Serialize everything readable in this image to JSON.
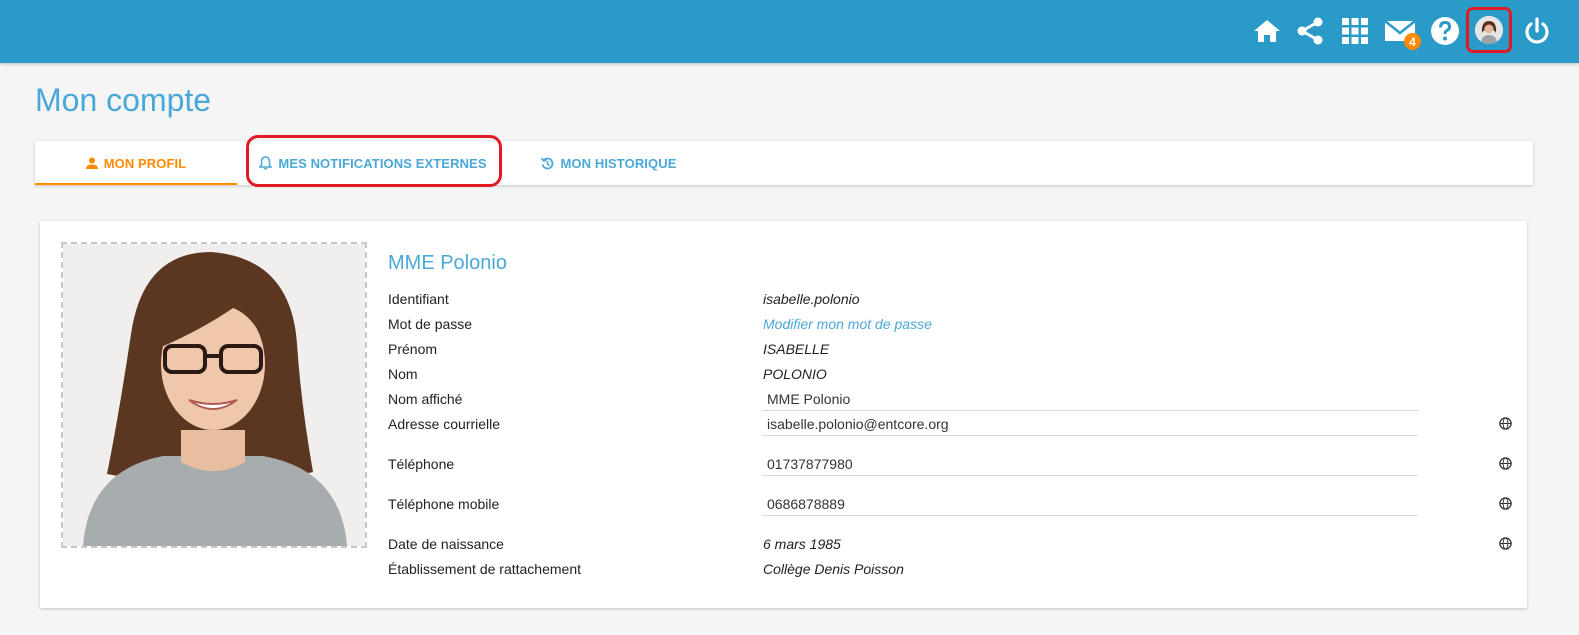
{
  "header": {
    "brand_color": "#2a9ac9",
    "icons": [
      "home-icon",
      "share-icon",
      "apps-grid-icon",
      "mail-icon",
      "help-icon",
      "user-avatar",
      "power-icon"
    ],
    "mail_badge": "4"
  },
  "page": {
    "title": "Mon compte"
  },
  "tabs": [
    {
      "label": "MON PROFIL",
      "icon": "person-icon",
      "active": true
    },
    {
      "label": "MES NOTIFICATIONS EXTERNES",
      "icon": "bell-icon",
      "active": false
    },
    {
      "label": "MON HISTORIQUE",
      "icon": "history-icon",
      "active": false
    }
  ],
  "profile": {
    "display_name": "MME Polonio",
    "rows": {
      "identifiant": {
        "label": "Identifiant",
        "value": "isabelle.polonio"
      },
      "password": {
        "label": "Mot de passe",
        "value": "Modifier mon mot de passe"
      },
      "prenom": {
        "label": "Prénom",
        "value": "ISABELLE"
      },
      "nom": {
        "label": "Nom",
        "value": "POLONIO"
      },
      "nom_affiche": {
        "label": "Nom affiché",
        "value": "MME Polonio"
      },
      "email": {
        "label": "Adresse courrielle",
        "value": "isabelle.polonio@entcore.org"
      },
      "telephone": {
        "label": "Téléphone",
        "value": "01737877980"
      },
      "mobile": {
        "label": "Téléphone mobile",
        "value": "0686878889"
      },
      "naissance": {
        "label": "Date de naissance",
        "value": "6 mars 1985"
      },
      "etablissement": {
        "label": "Établissement de rattachement",
        "value": "Collège Denis Poisson"
      }
    }
  },
  "colors": {
    "accent": "#4aa8d8",
    "active_tab": "#ff8a00",
    "highlight": "#e01b24"
  }
}
